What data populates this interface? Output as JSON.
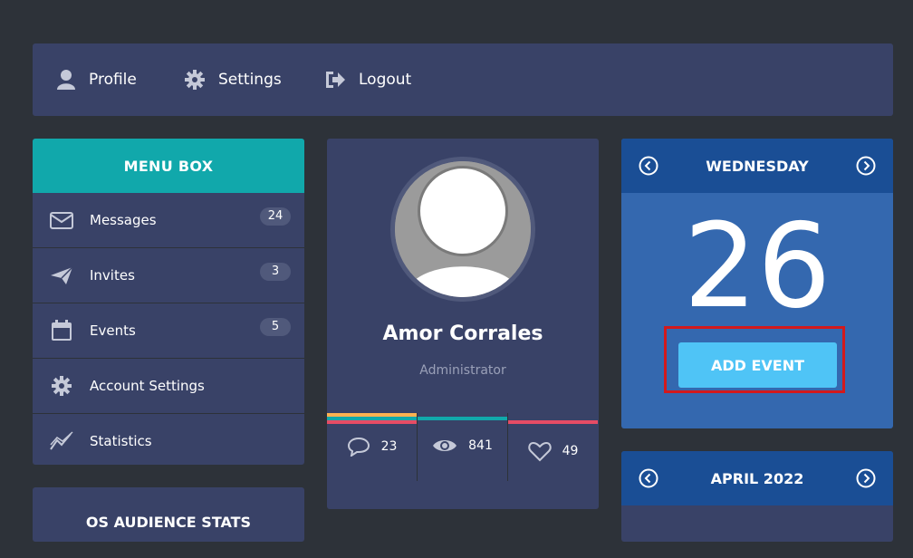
{
  "nav": {
    "profile": "Profile",
    "settings": "Settings",
    "logout": "Logout"
  },
  "menu": {
    "title": "MENU BOX",
    "items": [
      {
        "label": "Messages",
        "badge": "24",
        "icon": "envelope-icon"
      },
      {
        "label": "Invites",
        "badge": "3",
        "icon": "paper-plane-icon"
      },
      {
        "label": "Events",
        "badge": "5",
        "icon": "calendar-icon"
      },
      {
        "label": "Account Settings",
        "badge": "",
        "icon": "gear-icon"
      },
      {
        "label": "Statistics",
        "badge": "",
        "icon": "line-chart-icon"
      }
    ]
  },
  "audience": {
    "title": "OS AUDIENCE STATS"
  },
  "profile": {
    "name": "Amor Corrales",
    "role": "Administrator",
    "stats": [
      {
        "icon": "comment-icon",
        "value": "23",
        "color": "#e64c65"
      },
      {
        "icon": "eye-icon",
        "value": "841",
        "color": "#11a8ab"
      },
      {
        "icon": "heart-icon",
        "value": "49",
        "color": "#e64c65"
      }
    ]
  },
  "calendar": {
    "day_name": "WEDNESDAY",
    "day_number": "26",
    "add_event_label": "ADD EVENT"
  },
  "month": {
    "title": "APRIL 2022"
  },
  "colors": {
    "background": "#2d3239",
    "panel": "#394267",
    "teal": "#11a8ab",
    "calendar_blue": "#3468af",
    "calendar_header": "#1a4e95",
    "button_blue": "#4fc4f6",
    "pink": "#e64c65",
    "yellow": "#fcb150",
    "highlight_red": "#d3191c"
  }
}
